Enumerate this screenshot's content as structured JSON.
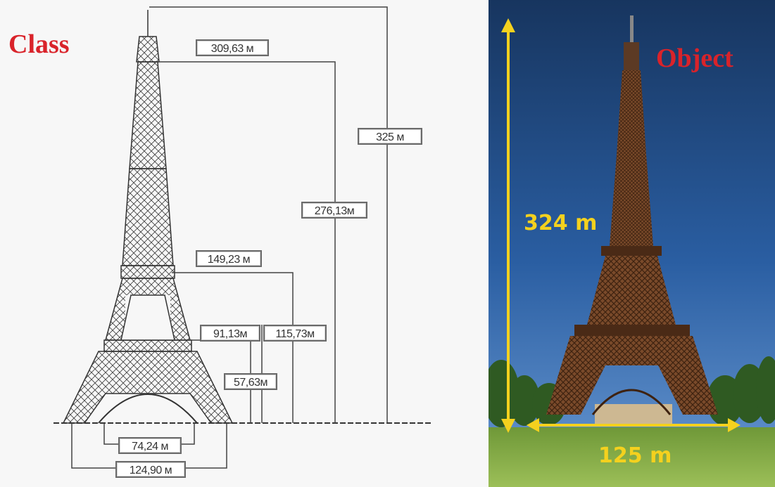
{
  "left_panel": {
    "title": "Class",
    "dimensions": {
      "d_309": "309,63 м",
      "d_325": "325 м",
      "d_276": "276,13м",
      "d_149": "149,23 м",
      "d_91": "91,13м",
      "d_115": "115,73м",
      "d_57": "57,63м",
      "d_74": "74,24 м",
      "d_124": "124,90 м"
    }
  },
  "right_panel": {
    "title": "Object",
    "height_label": "324 m",
    "width_label": "125 m"
  },
  "colors": {
    "title_red": "#d9232a",
    "sky_blue": "#1c3f73",
    "arrow_yellow": "#f4d11e",
    "tower_brown": "#6b3e22",
    "grass_green": "#7da63e"
  }
}
